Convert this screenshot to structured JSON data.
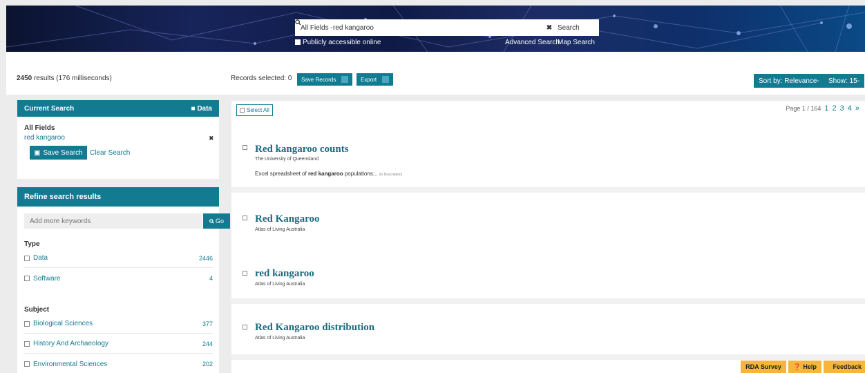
{
  "header": {
    "search_field": "All Fields -",
    "search_value": "red kangaroo",
    "clear_icon": "close-icon",
    "search_button": "Search",
    "public_checkbox": "Publicly accessible online",
    "advanced_search": "Advanced Search",
    "map_search": "Map Search"
  },
  "toolbar": {
    "results_count": "2450",
    "results_time": "results (176 milliseconds)",
    "records_selected": "Records selected: 0",
    "save_records": "Save Records",
    "export": "Export",
    "sort": "Sort by: Relevance-",
    "show": "Show: 15-"
  },
  "current_search": {
    "title": "Current Search",
    "data_label": "Data",
    "field_label": "All Fields",
    "term": "red kangaroo",
    "save_search": "Save Search",
    "clear_search": "Clear Search"
  },
  "refine": {
    "title": "Refine search results",
    "keyword_placeholder": "Add more keywords",
    "go": "Go",
    "type_label": "Type",
    "types": [
      {
        "label": "Data",
        "count": "2446"
      },
      {
        "label": "Software",
        "count": "4"
      }
    ],
    "subject_label": "Subject",
    "subjects": [
      {
        "label": "Biological Sciences",
        "count": "377"
      },
      {
        "label": "History And Archaeology",
        "count": "244"
      },
      {
        "label": "Environmental Sciences",
        "count": "202"
      }
    ]
  },
  "results": {
    "select_all": "Select All",
    "page_info": "Page 1 / 164",
    "pages": [
      "1",
      "2",
      "3",
      "4",
      "»"
    ],
    "items": [
      {
        "title": "Red kangaroo counts",
        "source": "The University of Queensland",
        "desc_pre": "Excel spreadsheet of ",
        "desc_bold": "red kangaroo",
        "desc_post": " populations...",
        "desc_note": "(in Description)"
      },
      {
        "title": "Red Kangaroo",
        "source": "Atlas of Living Australia"
      },
      {
        "title": "red kangaroo",
        "source": "Atlas of Living Australia"
      },
      {
        "title": "Red Kangaroo distribution",
        "source": "Atlas of Living Australia"
      }
    ]
  },
  "footer": {
    "rda_survey": "RDA Survey",
    "help": "Help",
    "feedback": "Feedback"
  }
}
